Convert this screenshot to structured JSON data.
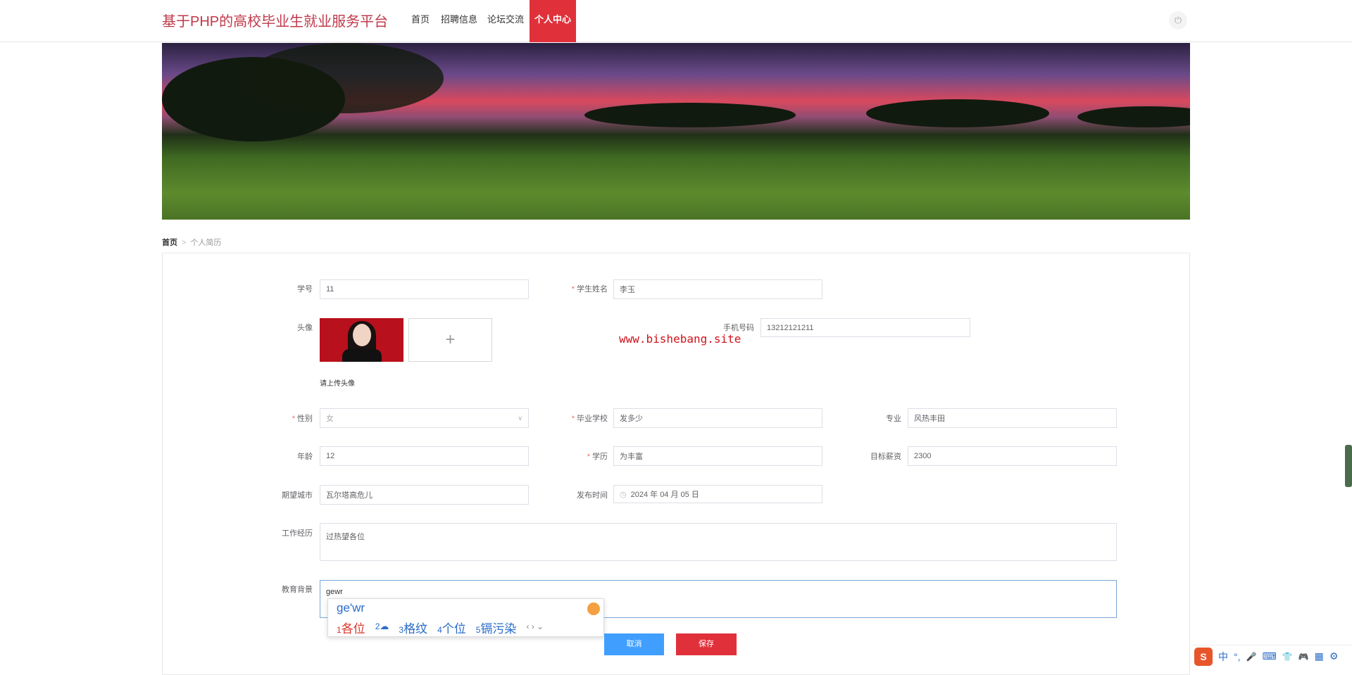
{
  "header": {
    "title": "基于PHP的高校毕业生就业服务平台",
    "nav": [
      "首页",
      "招聘信息",
      "论坛交流",
      "个人中心"
    ],
    "active": "个人中心",
    "power_icon": "⏻"
  },
  "breadcrumb": {
    "home": "首页",
    "sep": ">",
    "current": "个人简历"
  },
  "form": {
    "student_no": {
      "label": "学号",
      "value": "11"
    },
    "name": {
      "label": "学生姓名",
      "value": "李玉",
      "required": "*"
    },
    "avatar": {
      "label": "头像",
      "hint": "请上传头像",
      "plus": "+"
    },
    "phone": {
      "label": "手机号码",
      "value": "13212121211"
    },
    "gender": {
      "label": "性别",
      "value": "女",
      "required": "*"
    },
    "school": {
      "label": "毕业学校",
      "value": "发多少",
      "required": "*"
    },
    "major": {
      "label": "专业",
      "value": "风热丰田"
    },
    "age": {
      "label": "年龄",
      "value": "12"
    },
    "education": {
      "label": "学历",
      "value": "为丰富",
      "required": "*"
    },
    "salary": {
      "label": "目标薪资",
      "value": "2300"
    },
    "city": {
      "label": "期望城市",
      "value": "瓦尔塔高危儿"
    },
    "publish_time": {
      "label": "发布时间",
      "value": "2024 年 04 月 05 日"
    },
    "work": {
      "label": "工作经历",
      "value": "过热望各位"
    },
    "edu_bg": {
      "label": "教育背景",
      "value": "gewr"
    },
    "cancel": "取消",
    "save": "保存"
  },
  "watermark": "www.bishebang.site",
  "ime": {
    "composition": "ge'wr",
    "candidates": [
      {
        "n": "1",
        "t": "各位"
      },
      {
        "n": "2",
        "t": "☁"
      },
      {
        "n": "3",
        "t": "格纹"
      },
      {
        "n": "4",
        "t": "个位"
      },
      {
        "n": "5",
        "t": "镉污染"
      }
    ],
    "nav": "‹ › ⌄"
  },
  "taskbar": {
    "ime_logo": "S",
    "items": [
      "中",
      "°,",
      "🎤",
      "⌨",
      "👕",
      "🎮",
      "▦",
      "⚙"
    ]
  },
  "colors": {
    "accent": "#e0313b",
    "blue": "#409eff"
  }
}
